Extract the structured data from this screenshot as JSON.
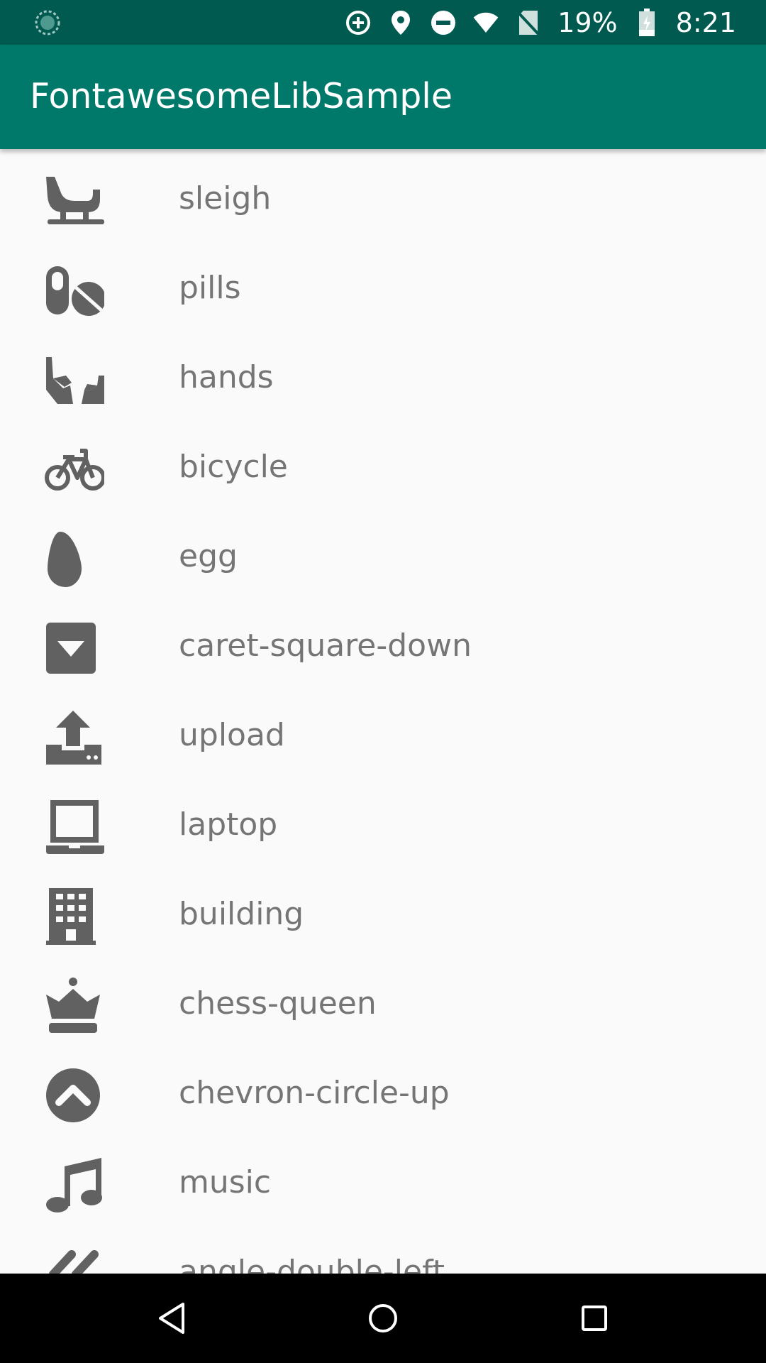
{
  "status_bar": {
    "battery": "19%",
    "time": "8:21",
    "icons": [
      "data-saver-icon",
      "location-icon",
      "do-not-disturb-icon",
      "wifi-icon",
      "no-sim-icon",
      "battery-icon"
    ]
  },
  "app_bar": {
    "title": "FontawesomeLibSample"
  },
  "list": {
    "items": [
      {
        "label": "sleigh",
        "icon": "sleigh-icon"
      },
      {
        "label": "pills",
        "icon": "pills-icon"
      },
      {
        "label": "hands",
        "icon": "hands-icon"
      },
      {
        "label": "bicycle",
        "icon": "bicycle-icon"
      },
      {
        "label": "egg",
        "icon": "egg-icon"
      },
      {
        "label": "caret-square-down",
        "icon": "caret-square-down-icon"
      },
      {
        "label": "upload",
        "icon": "upload-icon"
      },
      {
        "label": "laptop",
        "icon": "laptop-icon"
      },
      {
        "label": "building",
        "icon": "building-icon"
      },
      {
        "label": "chess-queen",
        "icon": "chess-queen-icon"
      },
      {
        "label": "chevron-circle-up",
        "icon": "chevron-circle-up-icon"
      },
      {
        "label": "music",
        "icon": "music-icon"
      },
      {
        "label": "angle-double-left",
        "icon": "angle-double-left-icon"
      }
    ]
  },
  "nav_bar": {
    "buttons": [
      "back-icon",
      "home-icon",
      "recents-icon"
    ]
  },
  "colors": {
    "status_bar": "#005a50",
    "app_bar": "#00796b",
    "background": "#fafafa",
    "icon": "#616161",
    "text": "#757575"
  }
}
